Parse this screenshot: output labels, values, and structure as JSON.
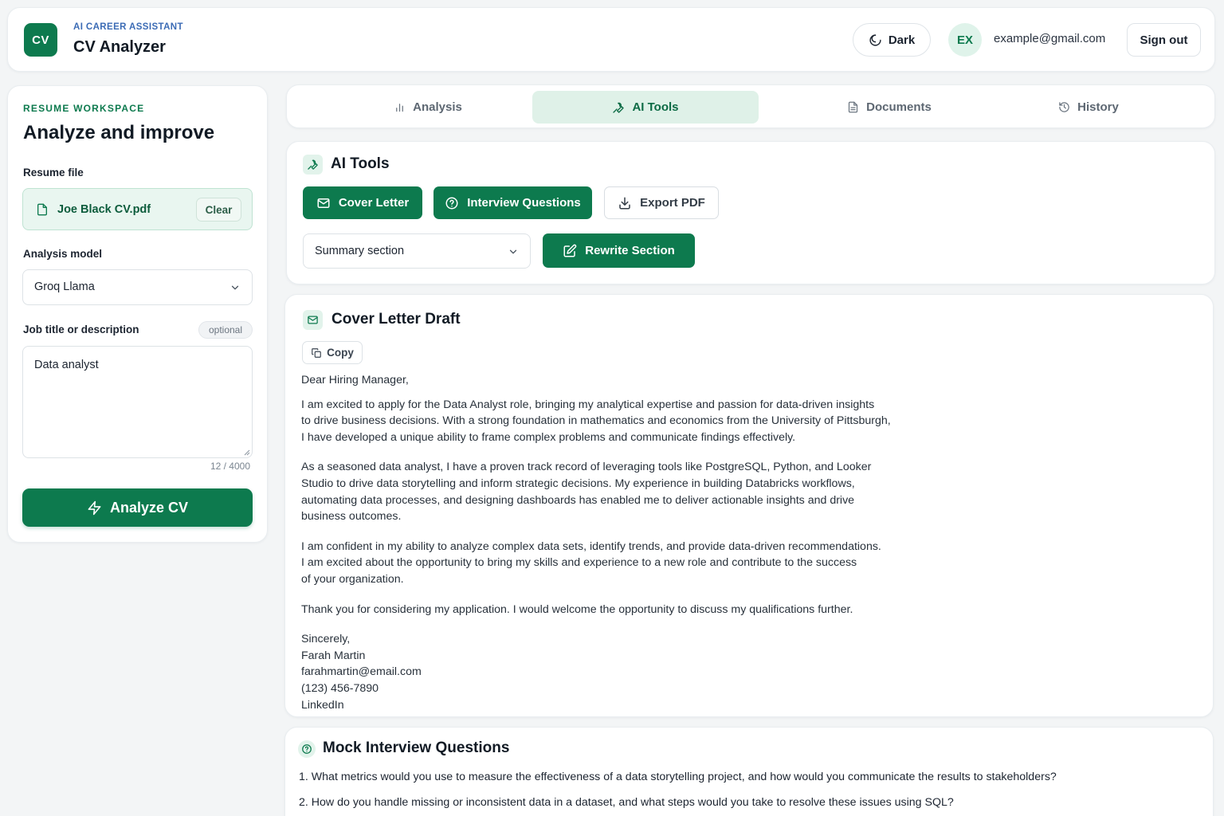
{
  "header": {
    "logo_text": "CV",
    "eyebrow": "AI CAREER ASSISTANT",
    "title": "CV Analyzer",
    "theme_label": "Dark",
    "avatar_initials": "EX",
    "user_email": "example@gmail.com",
    "signout_label": "Sign out"
  },
  "sidebar": {
    "eyebrow": "RESUME WORKSPACE",
    "title": "Analyze and improve",
    "resume_label": "Resume file",
    "file_name": "Joe Black CV.pdf",
    "clear_label": "Clear",
    "model_label": "Analysis model",
    "model_value": "Groq Llama",
    "job_label": "Job title or description",
    "optional_label": "optional",
    "job_value": "Data analyst",
    "char_count": "12 / 4000",
    "analyze_label": "Analyze CV"
  },
  "tabs": [
    {
      "label": "Analysis",
      "icon": "bar-chart-icon",
      "active": false
    },
    {
      "label": "AI Tools",
      "icon": "wrench-icon",
      "active": true
    },
    {
      "label": "Documents",
      "icon": "document-icon",
      "active": false
    },
    {
      "label": "History",
      "icon": "history-icon",
      "active": false
    }
  ],
  "tools": {
    "title": "AI Tools",
    "cover_letter_label": "Cover Letter",
    "interview_label": "Interview Questions",
    "export_label": "Export PDF",
    "section_select_value": "Summary section",
    "rewrite_label": "Rewrite Section"
  },
  "cover_letter": {
    "title": "Cover Letter Draft",
    "copy_label": "Copy",
    "greeting": "Dear Hiring Manager,",
    "para1": "I am excited to apply for the Data Analyst role, bringing my analytical expertise and passion for data-driven insights\nto drive business decisions. With a strong foundation in mathematics and economics from the University of Pittsburgh,\nI have developed a unique ability to frame complex problems and communicate findings effectively.",
    "para2": "As a seasoned data analyst, I have a proven track record of leveraging tools like PostgreSQL, Python, and Looker\nStudio to drive data storytelling and inform strategic decisions. My experience in building Databricks workflows,\nautomating data processes, and designing dashboards has enabled me to deliver actionable insights and drive\nbusiness outcomes.",
    "para3": "I am confident in my ability to analyze complex data sets, identify trends, and provide data-driven recommendations.\nI am excited about the opportunity to bring my skills and experience to a new role and contribute to the success\nof your organization.",
    "para4": "Thank you for considering my application. I would welcome the opportunity to discuss my qualifications further.",
    "signoff": "Sincerely,\nFarah Martin\nfarahmartin@email.com\n(123) 456-7890\nLinkedIn"
  },
  "mock_interview": {
    "title": "Mock Interview Questions",
    "questions": [
      "1.  What metrics would you use to measure the effectiveness of a data storytelling project, and how would you communicate the results to stakeholders?",
      "2.  How do you handle missing or inconsistent data in a dataset, and what steps would you take to resolve these issues using SQL?"
    ]
  },
  "colors": {
    "accent": "#0d7a4e",
    "accent_light": "#dff1e8",
    "background": "#f3f5f6"
  }
}
